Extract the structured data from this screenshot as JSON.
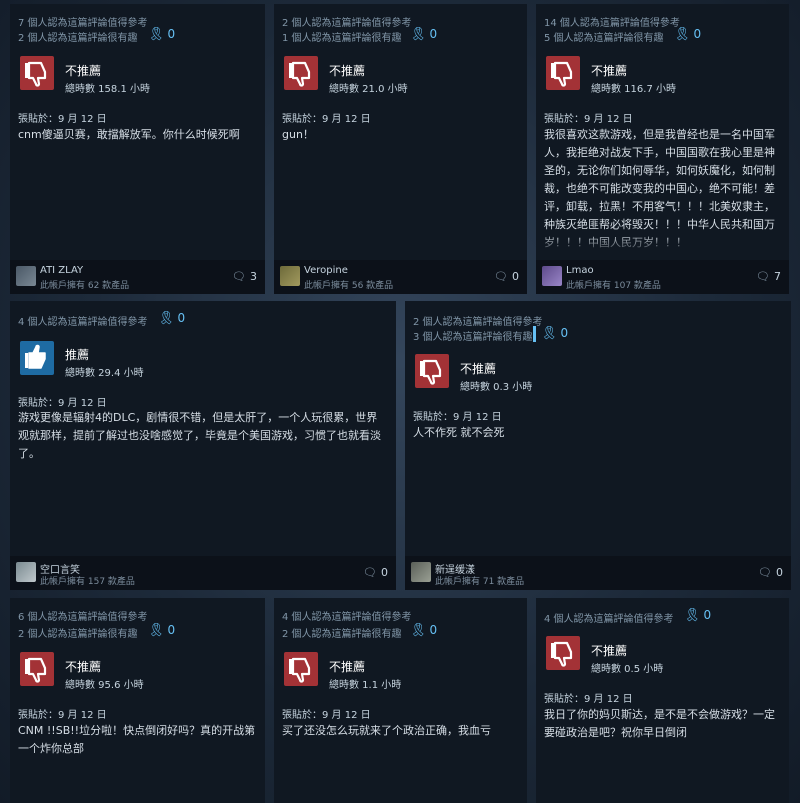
{
  "labels": {
    "not_recommended": "不推薦",
    "recommended": "推薦"
  },
  "reviews": [
    {
      "helpful": "7 個人認為這篇評論值得參考",
      "funny": "2 個人認為這篇評論很有趣",
      "awards": "0",
      "recommendation": "不推薦",
      "hours": "總時數 158.1 小時",
      "posted": "張貼於：9 月 12 日",
      "text": "cnm傻逼贝赛，敢擋解放军。你什么时候死啊",
      "user": "ATI ZLAY",
      "owns": "此帳戶擁有 62 款產品",
      "comments": "3"
    },
    {
      "helpful": "2 個人認為這篇評論值得參考",
      "funny": "1 個人認為這篇評論很有趣",
      "awards": "0",
      "recommendation": "不推薦",
      "hours": "總時數 21.0 小時",
      "posted": "張貼於：9 月 12 日",
      "text": "gun！",
      "user": "Veropine",
      "owns": "此帳戶擁有 56 款產品",
      "comments": "0"
    },
    {
      "helpful": "14 個人認為這篇評論值得參考",
      "funny": "5 個人認為這篇評論很有趣",
      "awards": "0",
      "recommendation": "不推薦",
      "hours": "總時數 116.7 小時",
      "posted": "張貼於：9 月 12 日",
      "text": "我很喜欢这款游戏，但是我曾经也是一名中国军人，我拒绝对战友下手，中国国歌在我心里是神圣的，无论你们如何辱华，如何妖魔化，如何制裁，也绝不可能改变我的中国心，绝不可能！差评，卸载，拉黑！不用客气！！！北美奴隶主，种族灭绝匪帮必将毁灭！！！中华人民共和国万岁！！！中国人民万岁！！！",
      "user": "Lmao",
      "owns": "此帳戶擁有 107 款產品",
      "comments": "7"
    },
    {
      "helpful": "4 個人認為這篇評論值得參考",
      "funny": "",
      "awards": "0",
      "recommendation": "推薦",
      "hours": "總時數 29.4 小時",
      "posted": "張貼於：9 月 12 日",
      "text": "游戏更像是辐射4的DLC，剧情很不错，但是太肝了，一个人玩很累，世界观就那样，提前了解过也没啥感觉了，毕竟是个美国游戏，习惯了也就看淡了。",
      "user": "空口言笑",
      "owns": "此帳戶擁有 157 款產品",
      "comments": "0"
    },
    {
      "helpful": "2 個人認為這篇評論值得參考",
      "funny": "3 個人認為這篇評論很有趣",
      "awards": "0",
      "recommendation": "不推薦",
      "hours": "總時數 0.3 小時",
      "posted": "張貼於：9 月 12 日",
      "text": "人不作死 就不会死",
      "user": "新逞缓漾",
      "owns": "此帳戶擁有 71 款產品",
      "comments": "0"
    },
    {
      "helpful": "6 個人認為這篇評論值得參考",
      "funny": "2 個人認為這篇評論很有趣",
      "awards": "0",
      "recommendation": "不推薦",
      "hours": "總時數 95.6 小時",
      "posted": "張貼於：9 月 12 日",
      "text": "CNM !!SB!!垃分啦！快点倒闭好吗？真的开战第一个炸你总部",
      "user": "",
      "owns": "",
      "comments": ""
    },
    {
      "helpful": "4 個人認為這篇評論值得參考",
      "funny": "2 個人認為這篇評論很有趣",
      "awards": "0",
      "recommendation": "不推薦",
      "hours": "總時數 1.1 小時",
      "posted": "張貼於：9 月 12 日",
      "text": "买了还没怎么玩就来了个政治正确，我血亏",
      "user": "",
      "owns": "",
      "comments": ""
    },
    {
      "helpful": "4 個人認為這篇評論值得參考",
      "funny": "",
      "awards": "0",
      "recommendation": "不推薦",
      "hours": "總時數 0.5 小時",
      "posted": "張貼於：9 月 12 日",
      "text": "我日了你的妈贝斯达，是不是不会做游戏？一定要碰政治是吧？祝你早日倒闭",
      "user": "",
      "owns": "",
      "comments": ""
    }
  ],
  "icons": {
    "award": "award-ribbon-icon",
    "comment": "comment-bubble-icon",
    "thumbs_down": "thumbs-down-icon",
    "thumbs_up": "thumbs-up-icon"
  },
  "colors": {
    "not_recommended": "#a33236",
    "recommended": "#1e6ba3",
    "award": "#66c0f4"
  }
}
